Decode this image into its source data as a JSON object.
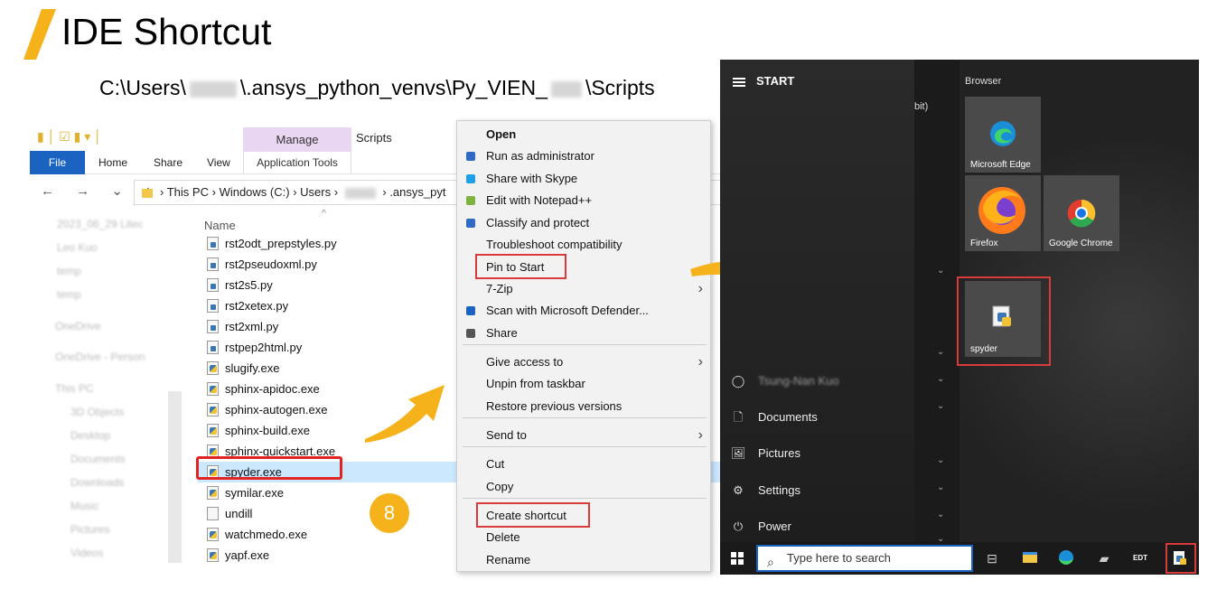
{
  "slide": {
    "title": "IDE Shortcut",
    "path_prefix": "C:\\Users\\",
    "path_mid": "\\.ansys_python_venvs\\Py_VIEN_",
    "path_suffix": "\\Scripts",
    "step_badge": "8",
    "accent_color": "#f6b21b"
  },
  "explorer": {
    "manage_tab": "Manage",
    "app_tools_tab": "Application Tools",
    "window_title": "Scripts",
    "tabs": {
      "file": "File",
      "home": "Home",
      "share": "Share",
      "view": "View"
    },
    "nav_arrows": "←  →  ⌄  ↑",
    "address_parts": [
      "This PC",
      "Windows (C:)",
      "Users",
      ".ansys_pyt"
    ],
    "address_sep": "›",
    "nav_items": [
      "2023_06_29 Litec",
      "Leo Kuo",
      "temp",
      "temp",
      "OneDrive",
      "OneDrive - Person",
      "This PC",
      "3D Objects",
      "Desktop",
      "Documents",
      "Downloads",
      "Music",
      "Pictures",
      "Videos"
    ],
    "column_name": "Name",
    "files": [
      {
        "name": "rst2odt_prepstyles.py",
        "kind": "py"
      },
      {
        "name": "rst2pseudoxml.py",
        "kind": "py"
      },
      {
        "name": "rst2s5.py",
        "kind": "py"
      },
      {
        "name": "rst2xetex.py",
        "kind": "py"
      },
      {
        "name": "rst2xml.py",
        "kind": "py"
      },
      {
        "name": "rstpep2html.py",
        "kind": "py"
      },
      {
        "name": "slugify.exe",
        "kind": "exe"
      },
      {
        "name": "sphinx-apidoc.exe",
        "kind": "exe"
      },
      {
        "name": "sphinx-autogen.exe",
        "kind": "exe"
      },
      {
        "name": "sphinx-build.exe",
        "kind": "exe"
      },
      {
        "name": "sphinx-quickstart.exe",
        "kind": "exe"
      },
      {
        "name": "spyder.exe",
        "kind": "exe"
      },
      {
        "name": "symilar.exe",
        "kind": "exe"
      },
      {
        "name": "undill",
        "kind": "blank"
      },
      {
        "name": "watchmedo.exe",
        "kind": "exe"
      },
      {
        "name": "yapf.exe",
        "kind": "exe"
      }
    ]
  },
  "context_menu": {
    "items": [
      {
        "label": "Open",
        "bold": true,
        "icon": ""
      },
      {
        "label": "Run as administrator",
        "icon": "shield-icon",
        "color": "#2f6bc4"
      },
      {
        "label": "Share with Skype",
        "icon": "skype-icon",
        "color": "#1fa0e6"
      },
      {
        "label": "Edit with Notepad++",
        "icon": "notepadpp-icon",
        "color": "#7fb241"
      },
      {
        "label": "Classify and protect",
        "icon": "lock-icon",
        "color": "#2f6bc4"
      },
      {
        "label": "Troubleshoot compatibility",
        "icon": ""
      },
      {
        "label": "Pin to Start",
        "icon": ""
      },
      {
        "label": "7-Zip",
        "icon": "",
        "submenu": true
      },
      {
        "label": "Scan with Microsoft Defender...",
        "icon": "defender-icon",
        "color": "#1a63c0"
      },
      {
        "label": "Share",
        "icon": "share-icon",
        "color": "#555555"
      },
      {
        "label": "Give access to",
        "icon": "",
        "submenu": true
      },
      {
        "label": "Unpin from taskbar",
        "icon": ""
      },
      {
        "label": "Restore previous versions",
        "icon": ""
      },
      {
        "label": "Send to",
        "icon": "",
        "submenu": true
      },
      {
        "label": "Cut",
        "icon": ""
      },
      {
        "label": "Copy",
        "icon": ""
      },
      {
        "label": "Create shortcut",
        "icon": ""
      },
      {
        "label": "Delete",
        "icon": ""
      },
      {
        "label": "Rename",
        "icon": ""
      }
    ]
  },
  "start_menu": {
    "header": "START",
    "bit_text": "bit)",
    "group_label": "Browser",
    "user_name": "Tsung-Nan Kuo",
    "sidebar": [
      {
        "label": "Documents",
        "icon": "document-icon",
        "glyph": "🗋"
      },
      {
        "label": "Pictures",
        "icon": "pictures-icon",
        "glyph": "🖼"
      },
      {
        "label": "Settings",
        "icon": "gear-icon",
        "glyph": "⚙"
      },
      {
        "label": "Power",
        "icon": "power-icon",
        "glyph": "⏻"
      }
    ],
    "tiles": [
      {
        "label": "Microsoft Edge",
        "icon": "edge-icon"
      },
      {
        "label": "Firefox",
        "icon": "firefox-icon"
      },
      {
        "label": "Google Chrome",
        "icon": "chrome-icon"
      },
      {
        "label": "spyder",
        "icon": "spyder-icon"
      }
    ],
    "search_placeholder": "Type here to search",
    "taskbar_edt": "EDT"
  }
}
